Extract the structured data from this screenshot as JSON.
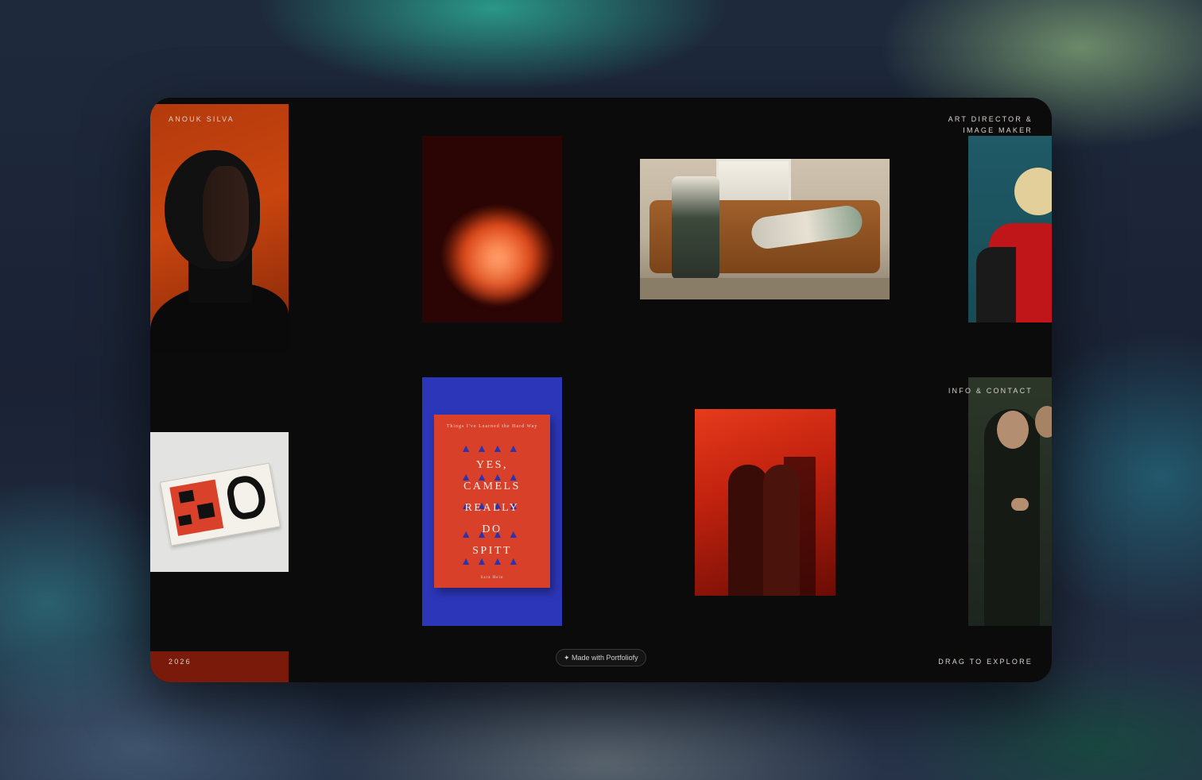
{
  "site": {
    "name": "ANOUK SILVA",
    "role_line1": "ART DIRECTOR &",
    "role_line2": "IMAGE MAKER",
    "nav_info": "INFO & CONTACT",
    "year": "2026",
    "hint": "DRAG TO EXPLORE",
    "badge": "✦ Made with Portfoliofy"
  },
  "book_cover": {
    "kicker": "Things I've Learned the Hard Way",
    "title_lines": [
      "YES,",
      "CAMELS",
      "REALLY",
      "DO",
      "SPITT"
    ],
    "author": "Sara Hein"
  },
  "colors": {
    "accent_red": "#c9450f",
    "cover_blue": "#2c36b8",
    "window_bg": "#0b0b0b"
  }
}
